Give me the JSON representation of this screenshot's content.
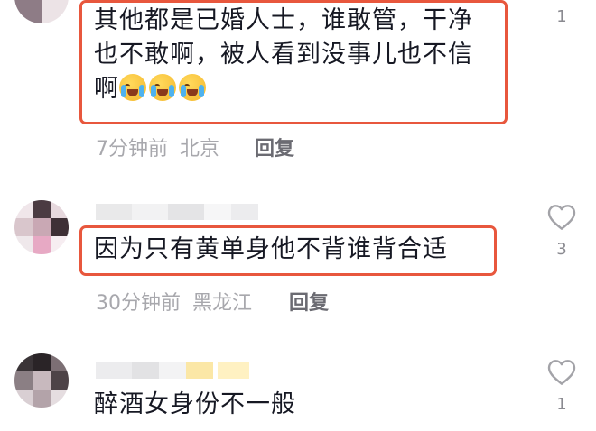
{
  "comments": [
    {
      "text_lines": [
        "其他都是已婚人士，谁敢管，干净",
        "也不敢啊，被人看到没事儿也不信",
        "啊"
      ],
      "emoji_count": 3,
      "emoji_icon": "loudly-crying-face",
      "time": "7分钟前",
      "location": "北京",
      "reply_label": "回复",
      "likes": "1",
      "highlighted": true
    },
    {
      "text": "因为只有黄单身他不背谁背合适",
      "time": "30分钟前",
      "location": "黑龙江",
      "reply_label": "回复",
      "likes": "3",
      "highlighted": true
    },
    {
      "text": "醉酒女身份不一般",
      "likes": "1",
      "highlighted": false
    }
  ],
  "icons": {
    "like": "heart-outline-icon",
    "avatar": "pixelated-avatar"
  },
  "colors": {
    "highlight": "#e8573d",
    "meta": "#a8a8ad",
    "text": "#161823"
  }
}
